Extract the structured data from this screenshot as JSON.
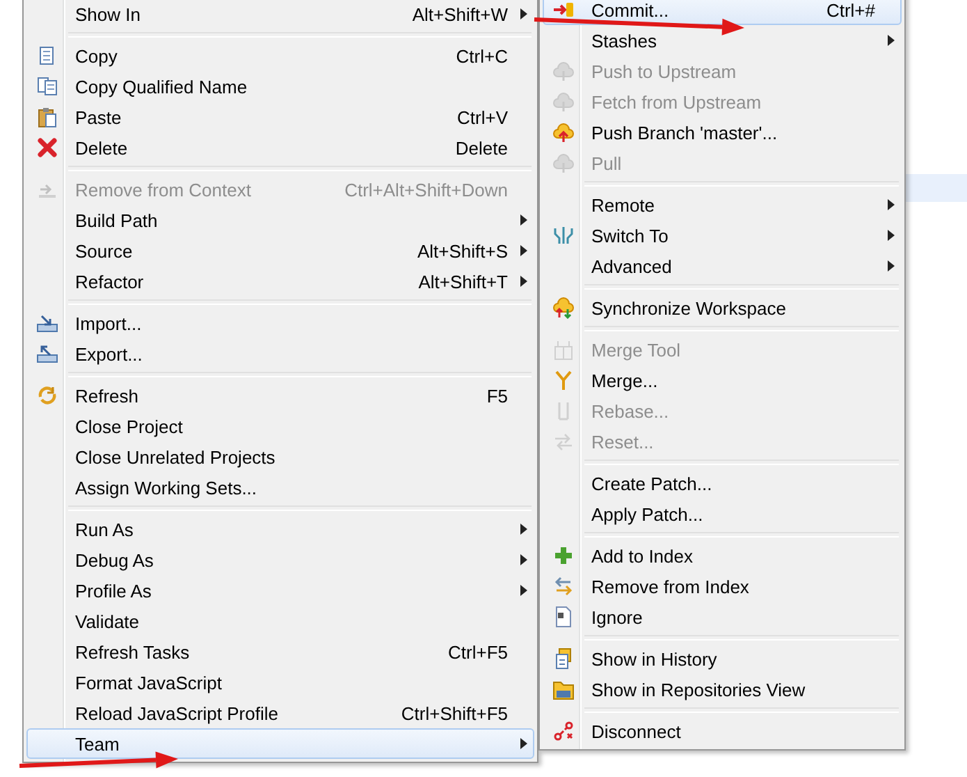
{
  "context_menu": {
    "sections": [
      [
        {
          "label": "Show In",
          "shortcut": "Alt+Shift+W",
          "submenu": true,
          "disabled": false,
          "selected": false
        }
      ],
      [
        {
          "label": "Copy",
          "shortcut": "Ctrl+C",
          "submenu": false,
          "disabled": false,
          "selected": false
        },
        {
          "label": "Copy Qualified Name",
          "submenu": false,
          "disabled": false,
          "selected": false
        },
        {
          "label": "Paste",
          "shortcut": "Ctrl+V",
          "submenu": false,
          "disabled": false,
          "selected": false
        },
        {
          "label": "Delete",
          "shortcut": "Delete",
          "submenu": false,
          "disabled": false,
          "selected": false
        }
      ],
      [
        {
          "label": "Remove from Context",
          "shortcut": "Ctrl+Alt+Shift+Down",
          "submenu": false,
          "disabled": true,
          "selected": false
        },
        {
          "label": "Build Path",
          "submenu": true,
          "disabled": false,
          "selected": false
        },
        {
          "label": "Source",
          "shortcut": "Alt+Shift+S",
          "submenu": true,
          "disabled": false,
          "selected": false
        },
        {
          "label": "Refactor",
          "shortcut": "Alt+Shift+T",
          "submenu": true,
          "disabled": false,
          "selected": false
        }
      ],
      [
        {
          "label": "Import...",
          "submenu": false,
          "disabled": false,
          "selected": false
        },
        {
          "label": "Export...",
          "submenu": false,
          "disabled": false,
          "selected": false
        }
      ],
      [
        {
          "label": "Refresh",
          "shortcut": "F5",
          "submenu": false,
          "disabled": false,
          "selected": false
        },
        {
          "label": "Close Project",
          "submenu": false,
          "disabled": false,
          "selected": false
        },
        {
          "label": "Close Unrelated Projects",
          "submenu": false,
          "disabled": false,
          "selected": false
        },
        {
          "label": "Assign Working Sets...",
          "submenu": false,
          "disabled": false,
          "selected": false
        }
      ],
      [
        {
          "label": "Run As",
          "submenu": true,
          "disabled": false,
          "selected": false
        },
        {
          "label": "Debug As",
          "submenu": true,
          "disabled": false,
          "selected": false
        },
        {
          "label": "Profile As",
          "submenu": true,
          "disabled": false,
          "selected": false
        },
        {
          "label": "Validate",
          "submenu": false,
          "disabled": false,
          "selected": false
        },
        {
          "label": "Refresh Tasks",
          "shortcut": "Ctrl+F5",
          "submenu": false,
          "disabled": false,
          "selected": false
        },
        {
          "label": "Format JavaScript",
          "submenu": false,
          "disabled": false,
          "selected": false
        },
        {
          "label": "Reload JavaScript Profile",
          "shortcut": "Ctrl+Shift+F5",
          "submenu": false,
          "disabled": false,
          "selected": false
        },
        {
          "label": "Team",
          "submenu": true,
          "disabled": false,
          "selected": true
        }
      ]
    ]
  },
  "team_submenu": {
    "sections": [
      [
        {
          "label": "Commit...",
          "shortcut": "Ctrl+#",
          "submenu": false,
          "disabled": false,
          "selected": true
        },
        {
          "label": "Stashes",
          "submenu": true,
          "disabled": false,
          "selected": false
        },
        {
          "label": "Push to Upstream",
          "submenu": false,
          "disabled": true,
          "selected": false
        },
        {
          "label": "Fetch from Upstream",
          "submenu": false,
          "disabled": true,
          "selected": false
        },
        {
          "label": "Push Branch 'master'...",
          "submenu": false,
          "disabled": false,
          "selected": false
        },
        {
          "label": "Pull",
          "submenu": false,
          "disabled": true,
          "selected": false
        }
      ],
      [
        {
          "label": "Remote",
          "submenu": true,
          "disabled": false,
          "selected": false
        },
        {
          "label": "Switch To",
          "submenu": true,
          "disabled": false,
          "selected": false
        },
        {
          "label": "Advanced",
          "submenu": true,
          "disabled": false,
          "selected": false
        }
      ],
      [
        {
          "label": "Synchronize Workspace",
          "submenu": false,
          "disabled": false,
          "selected": false
        }
      ],
      [
        {
          "label": "Merge Tool",
          "submenu": false,
          "disabled": true,
          "selected": false
        },
        {
          "label": "Merge...",
          "submenu": false,
          "disabled": false,
          "selected": false
        },
        {
          "label": "Rebase...",
          "submenu": false,
          "disabled": true,
          "selected": false
        },
        {
          "label": "Reset...",
          "submenu": false,
          "disabled": true,
          "selected": false
        }
      ],
      [
        {
          "label": "Create Patch...",
          "submenu": false,
          "disabled": false,
          "selected": false
        },
        {
          "label": "Apply Patch...",
          "submenu": false,
          "disabled": false,
          "selected": false
        }
      ],
      [
        {
          "label": "Add to Index",
          "submenu": false,
          "disabled": false,
          "selected": false
        },
        {
          "label": "Remove from Index",
          "submenu": false,
          "disabled": false,
          "selected": false
        },
        {
          "label": "Ignore",
          "submenu": false,
          "disabled": false,
          "selected": false
        }
      ],
      [
        {
          "label": "Show in History",
          "submenu": false,
          "disabled": false,
          "selected": false
        },
        {
          "label": "Show in Repositories View",
          "submenu": false,
          "disabled": false,
          "selected": false
        }
      ],
      [
        {
          "label": "Disconnect",
          "submenu": false,
          "disabled": false,
          "selected": false
        }
      ]
    ]
  }
}
